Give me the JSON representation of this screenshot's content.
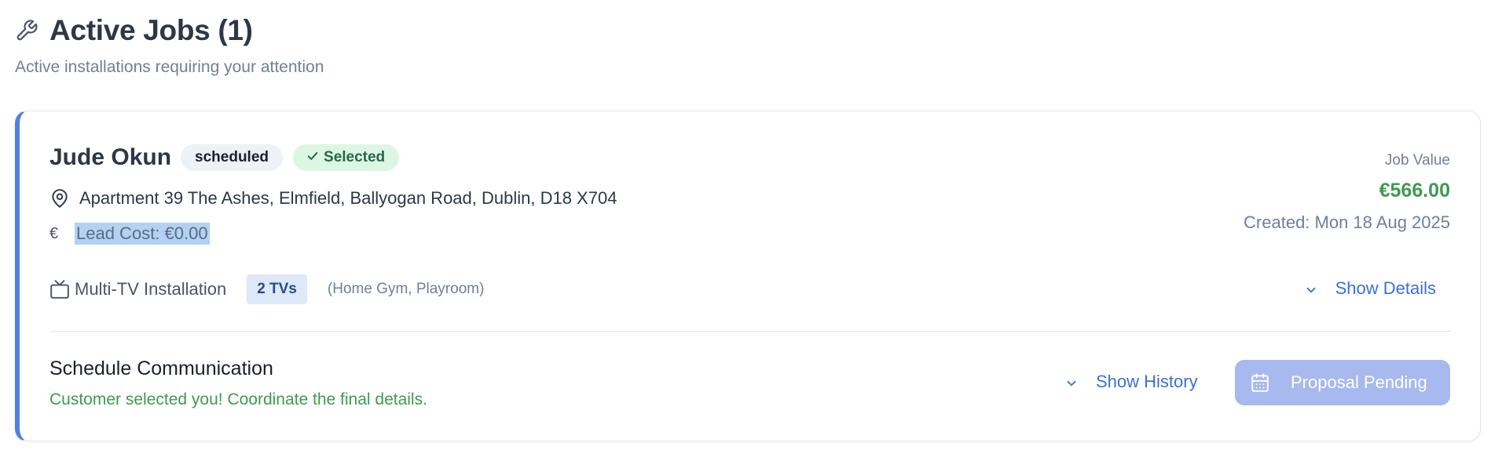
{
  "header": {
    "icon": "wrench-icon",
    "title": "Active Jobs (1)",
    "subtitle": "Active installations requiring your attention"
  },
  "job": {
    "customer_name": "Jude Okun",
    "status_badge": "scheduled",
    "selected_badge": "Selected",
    "address": "Apartment 39 The Ashes, Elmfield, Ballyogan Road, Dublin, D18 X704",
    "lead_cost": "Lead Cost: €0.00",
    "job_value_label": "Job Value",
    "job_value": "€566.00",
    "created": "Created: Mon 18 Aug 2025",
    "service": "Multi-TV Installation",
    "tv_count_badge": "2 TVs",
    "rooms": "(Home Gym, Playroom)",
    "show_details_label": "Show Details"
  },
  "schedule": {
    "title": "Schedule Communication",
    "message": "Customer selected you! Coordinate the final details.",
    "show_history_label": "Show History",
    "proposal_button_label": "Proposal Pending"
  },
  "colors": {
    "accent_border": "#4f80e1",
    "link_blue": "#3b6fd8",
    "success_green": "#3f9a4f",
    "button_disabled": "#a7b9ee"
  }
}
